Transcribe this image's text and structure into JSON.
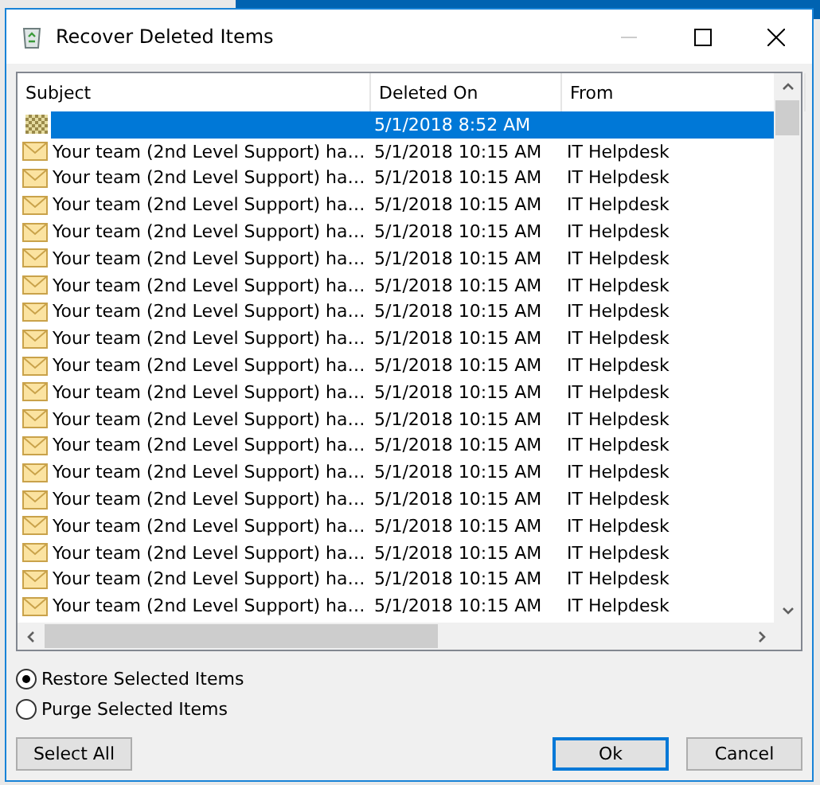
{
  "window": {
    "title": "Recover Deleted Items"
  },
  "table": {
    "columns": [
      "Subject",
      "Deleted On",
      "From"
    ],
    "rows": [
      {
        "kind": "unknown",
        "selected": true,
        "deleted_on": "5/1/2018 8:52 AM"
      },
      {
        "kind": "mail",
        "selected": false,
        "subject": "Your team (2nd Level Support) ha…",
        "deleted_on": "5/1/2018 10:15 AM",
        "from": "IT Helpdesk"
      },
      {
        "kind": "mail",
        "selected": false,
        "subject": "Your team (2nd Level Support) ha…",
        "deleted_on": "5/1/2018 10:15 AM",
        "from": "IT Helpdesk"
      },
      {
        "kind": "mail",
        "selected": false,
        "subject": "Your team (2nd Level Support) ha…",
        "deleted_on": "5/1/2018 10:15 AM",
        "from": "IT Helpdesk"
      },
      {
        "kind": "mail",
        "selected": false,
        "subject": "Your team (2nd Level Support) ha…",
        "deleted_on": "5/1/2018 10:15 AM",
        "from": "IT Helpdesk"
      },
      {
        "kind": "mail",
        "selected": false,
        "subject": "Your team (2nd Level Support) ha…",
        "deleted_on": "5/1/2018 10:15 AM",
        "from": "IT Helpdesk"
      },
      {
        "kind": "mail",
        "selected": false,
        "subject": "Your team (2nd Level Support) ha…",
        "deleted_on": "5/1/2018 10:15 AM",
        "from": "IT Helpdesk"
      },
      {
        "kind": "mail",
        "selected": false,
        "subject": "Your team (2nd Level Support) ha…",
        "deleted_on": "5/1/2018 10:15 AM",
        "from": "IT Helpdesk"
      },
      {
        "kind": "mail",
        "selected": false,
        "subject": "Your team (2nd Level Support) ha…",
        "deleted_on": "5/1/2018 10:15 AM",
        "from": "IT Helpdesk"
      },
      {
        "kind": "mail",
        "selected": false,
        "subject": "Your team (2nd Level Support) ha…",
        "deleted_on": "5/1/2018 10:15 AM",
        "from": "IT Helpdesk"
      },
      {
        "kind": "mail",
        "selected": false,
        "subject": "Your team (2nd Level Support) ha…",
        "deleted_on": "5/1/2018 10:15 AM",
        "from": "IT Helpdesk"
      },
      {
        "kind": "mail",
        "selected": false,
        "subject": "Your team (2nd Level Support) ha…",
        "deleted_on": "5/1/2018 10:15 AM",
        "from": "IT Helpdesk"
      },
      {
        "kind": "mail",
        "selected": false,
        "subject": "Your team (2nd Level Support) ha…",
        "deleted_on": "5/1/2018 10:15 AM",
        "from": "IT Helpdesk"
      },
      {
        "kind": "mail",
        "selected": false,
        "subject": "Your team (2nd Level Support) ha…",
        "deleted_on": "5/1/2018 10:15 AM",
        "from": "IT Helpdesk"
      },
      {
        "kind": "mail",
        "selected": false,
        "subject": "Your team (2nd Level Support) ha…",
        "deleted_on": "5/1/2018 10:15 AM",
        "from": "IT Helpdesk"
      },
      {
        "kind": "mail",
        "selected": false,
        "subject": "Your team (2nd Level Support) ha…",
        "deleted_on": "5/1/2018 10:15 AM",
        "from": "IT Helpdesk"
      },
      {
        "kind": "mail",
        "selected": false,
        "subject": "Your team (2nd Level Support) ha…",
        "deleted_on": "5/1/2018 10:15 AM",
        "from": "IT Helpdesk"
      },
      {
        "kind": "mail",
        "selected": false,
        "subject": "Your team (2nd Level Support) ha…",
        "deleted_on": "5/1/2018 10:15 AM",
        "from": "IT Helpdesk"
      },
      {
        "kind": "mail",
        "selected": false,
        "subject": "Your team (2nd Level Support) ha…",
        "deleted_on": "5/1/2018 10:15 AM",
        "from": "IT Helpdesk"
      }
    ]
  },
  "options": [
    {
      "label": "Restore Selected Items",
      "selected": true
    },
    {
      "label": "Purge Selected Items",
      "selected": false
    }
  ],
  "buttons": [
    {
      "label": "Select All",
      "default": false
    },
    {
      "label": "Ok",
      "default": true
    },
    {
      "label": "Cancel",
      "default": false
    }
  ]
}
